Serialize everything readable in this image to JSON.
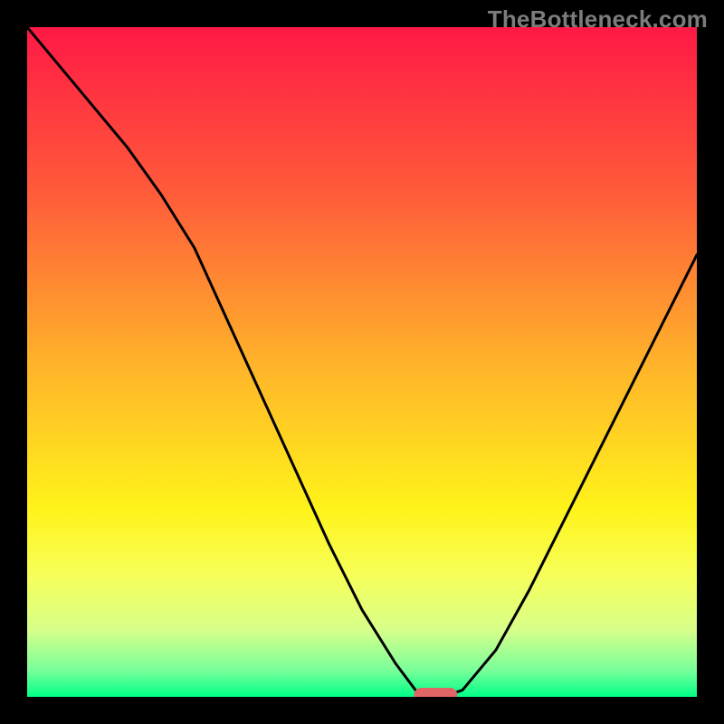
{
  "watermark": "TheBottleneck.com",
  "chart_data": {
    "type": "line",
    "title": "",
    "xlabel": "",
    "ylabel": "",
    "xlim": [
      0,
      100
    ],
    "ylim": [
      0,
      100
    ],
    "x": [
      0,
      5,
      10,
      15,
      20,
      25,
      30,
      35,
      40,
      45,
      50,
      55,
      58,
      60,
      62,
      65,
      70,
      75,
      80,
      85,
      90,
      95,
      100
    ],
    "values": [
      100,
      94,
      88,
      82,
      75,
      67,
      56,
      45,
      34,
      23,
      13,
      5,
      1,
      0,
      0,
      1,
      7,
      16,
      26,
      36,
      46,
      56,
      66
    ],
    "marker": {
      "x": 61,
      "y": 0
    },
    "gradient_stops": [
      {
        "offset": 0.0,
        "color": "#ff1945"
      },
      {
        "offset": 0.25,
        "color": "#ff5c3a"
      },
      {
        "offset": 0.5,
        "color": "#ffb22a"
      },
      {
        "offset": 0.72,
        "color": "#fff31a"
      },
      {
        "offset": 0.82,
        "color": "#f6ff5a"
      },
      {
        "offset": 0.9,
        "color": "#d7ff8a"
      },
      {
        "offset": 0.96,
        "color": "#7aff9a"
      },
      {
        "offset": 1.0,
        "color": "#00ff88"
      }
    ]
  }
}
